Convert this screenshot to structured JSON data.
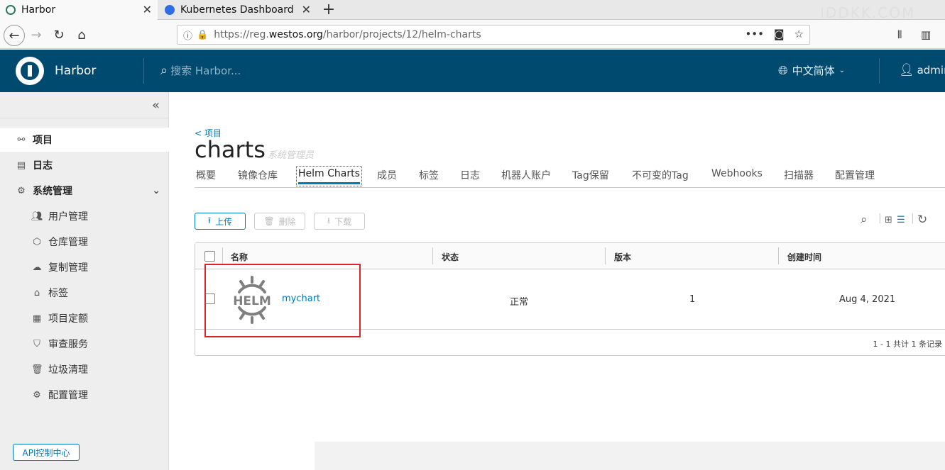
{
  "browser": {
    "tabs": [
      {
        "title": "Harbor"
      },
      {
        "title": "Kubernetes Dashboard"
      }
    ],
    "url": {
      "prefix": "https://reg.",
      "host": "westos.org",
      "path": "/harbor/projects/12/helm-charts"
    },
    "watermark": "IDDKK.COM"
  },
  "header": {
    "brand": "Harbor",
    "search_placeholder": "搜索 Harbor...",
    "language": "中文简体",
    "user": "admin"
  },
  "sidebar": {
    "items": [
      {
        "label": "项目"
      },
      {
        "label": "日志"
      },
      {
        "label": "系统管理"
      }
    ],
    "admin_items": [
      {
        "label": "用户管理"
      },
      {
        "label": "仓库管理"
      },
      {
        "label": "复制管理"
      },
      {
        "label": "标签"
      },
      {
        "label": "项目定额"
      },
      {
        "label": "审查服务"
      },
      {
        "label": "垃圾清理"
      },
      {
        "label": "配置管理"
      }
    ],
    "api_button": "API控制中心"
  },
  "main": {
    "breadcrumb": "< 项目",
    "title": "charts",
    "role": "系统管理员",
    "tabs": [
      {
        "label": "概要"
      },
      {
        "label": "镜像仓库"
      },
      {
        "label": "Helm Charts"
      },
      {
        "label": "成员"
      },
      {
        "label": "标签"
      },
      {
        "label": "日志"
      },
      {
        "label": "机器人账户"
      },
      {
        "label": "Tag保留"
      },
      {
        "label": "不可变的Tag"
      },
      {
        "label": "Webhooks"
      },
      {
        "label": "扫描器"
      },
      {
        "label": "配置管理"
      }
    ],
    "active_tab": "Helm Charts",
    "toolbar": {
      "upload": "上传",
      "delete": "删除",
      "download": "下载"
    },
    "table": {
      "headers": {
        "name": "名称",
        "status": "状态",
        "version": "版本",
        "created": "创建时间"
      },
      "rows": [
        {
          "name": "mychart",
          "status": "正常",
          "version": "1",
          "created": "Aug 4, 2021",
          "logo": "HELM"
        }
      ],
      "footer": "1 - 1 共计 1 条记录"
    }
  },
  "colors": {
    "header_bg": "#004a70",
    "accent": "#0079b8",
    "highlight_box": "#d9262b"
  }
}
